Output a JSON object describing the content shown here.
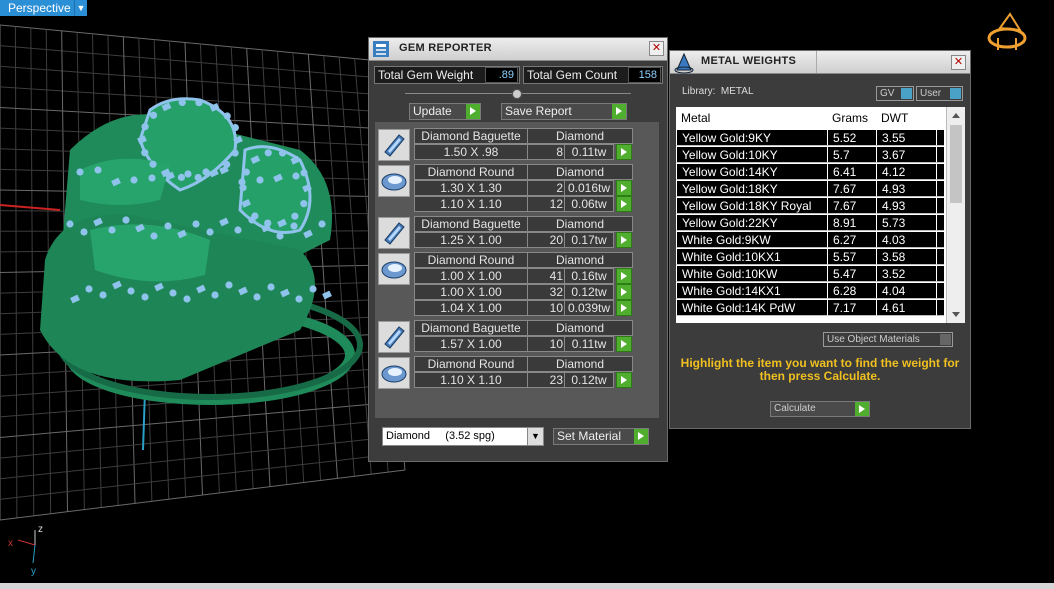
{
  "viewport": {
    "label": "Perspective",
    "axis_x": "x",
    "axis_y": "y",
    "axis_z": "z"
  },
  "gem_reporter": {
    "title": "GEM REPORTER",
    "total_gem_weight_label": "Total Gem Weight",
    "total_gem_weight": ".89",
    "total_gem_count_label": "Total Gem Count",
    "total_gem_count": "158",
    "update_label": "Update",
    "save_report_label": "Save Report",
    "groups": [
      {
        "cut": "Diamond Baguette",
        "material": "Diamond",
        "icon": "baguette-gem-icon",
        "rows": [
          {
            "size": "1.50 X .98",
            "count": "8",
            "tw": "0.11tw"
          }
        ]
      },
      {
        "cut": "Diamond Round",
        "material": "Diamond",
        "icon": "round-gem-icon",
        "rows": [
          {
            "size": "1.30 X 1.30",
            "count": "2",
            "tw": "0.016tw"
          },
          {
            "size": "1.10 X 1.10",
            "count": "12",
            "tw": "0.06tw"
          }
        ]
      },
      {
        "cut": "Diamond Baguette",
        "material": "Diamond",
        "icon": "baguette-gem-icon",
        "rows": [
          {
            "size": "1.25 X 1.00",
            "count": "20",
            "tw": "0.17tw"
          }
        ]
      },
      {
        "cut": "Diamond Round",
        "material": "Diamond",
        "icon": "round-gem-icon",
        "rows": [
          {
            "size": "1.00 X 1.00",
            "count": "41",
            "tw": "0.16tw"
          },
          {
            "size": "1.00 X 1.00",
            "count": "32",
            "tw": "0.12tw"
          },
          {
            "size": "1.04 X 1.00",
            "count": "10",
            "tw": "0.039tw"
          }
        ]
      },
      {
        "cut": "Diamond Baguette",
        "material": "Diamond",
        "icon": "baguette-gem-icon",
        "rows": [
          {
            "size": "1.57 X 1.00",
            "count": "10",
            "tw": "0.11tw"
          }
        ]
      },
      {
        "cut": "Diamond Round",
        "material": "Diamond",
        "icon": "round-gem-icon",
        "rows": [
          {
            "size": "1.10 X 1.10",
            "count": "23",
            "tw": "0.12tw"
          }
        ]
      }
    ],
    "material_select": "Diamond     (3.52 spg)",
    "set_material_label": "Set Material"
  },
  "metal_weights": {
    "title": "METAL WEIGHTS",
    "library_label": "Library:  METAL",
    "gv_label": "GV",
    "user_label": "User",
    "columns": [
      "Metal",
      "Grams",
      "DWT"
    ],
    "rows": [
      [
        "Yellow Gold:9KY",
        "5.52",
        "3.55"
      ],
      [
        "Yellow Gold:10KY",
        "5.7",
        "3.67"
      ],
      [
        "Yellow Gold:14KY",
        "6.41",
        "4.12"
      ],
      [
        "Yellow Gold:18KY",
        "7.67",
        "4.93"
      ],
      [
        "Yellow Gold:18KY Royal",
        "7.67",
        "4.93"
      ],
      [
        "Yellow Gold:22KY",
        "8.91",
        "5.73"
      ],
      [
        "White Gold:9KW",
        "6.27",
        "4.03"
      ],
      [
        "White Gold:10KX1",
        "5.57",
        "3.58"
      ],
      [
        "White Gold:10KW",
        "5.47",
        "3.52"
      ],
      [
        "White Gold:14KX1",
        "6.28",
        "4.04"
      ],
      [
        "White Gold:14K PdW",
        "7.17",
        "4.61"
      ]
    ],
    "use_object_materials_label": "Use Object Materials",
    "hint": "Highlight the item you want to find the weight for then press Calculate.",
    "calculate_label": "Calculate"
  },
  "colors": {
    "ring": "#1f8a5a",
    "gem": "#8fc3ec",
    "accent_green": "#4fae2d",
    "hint_yellow": "#f0c020",
    "viewport_tab": "#2b8fd6"
  }
}
